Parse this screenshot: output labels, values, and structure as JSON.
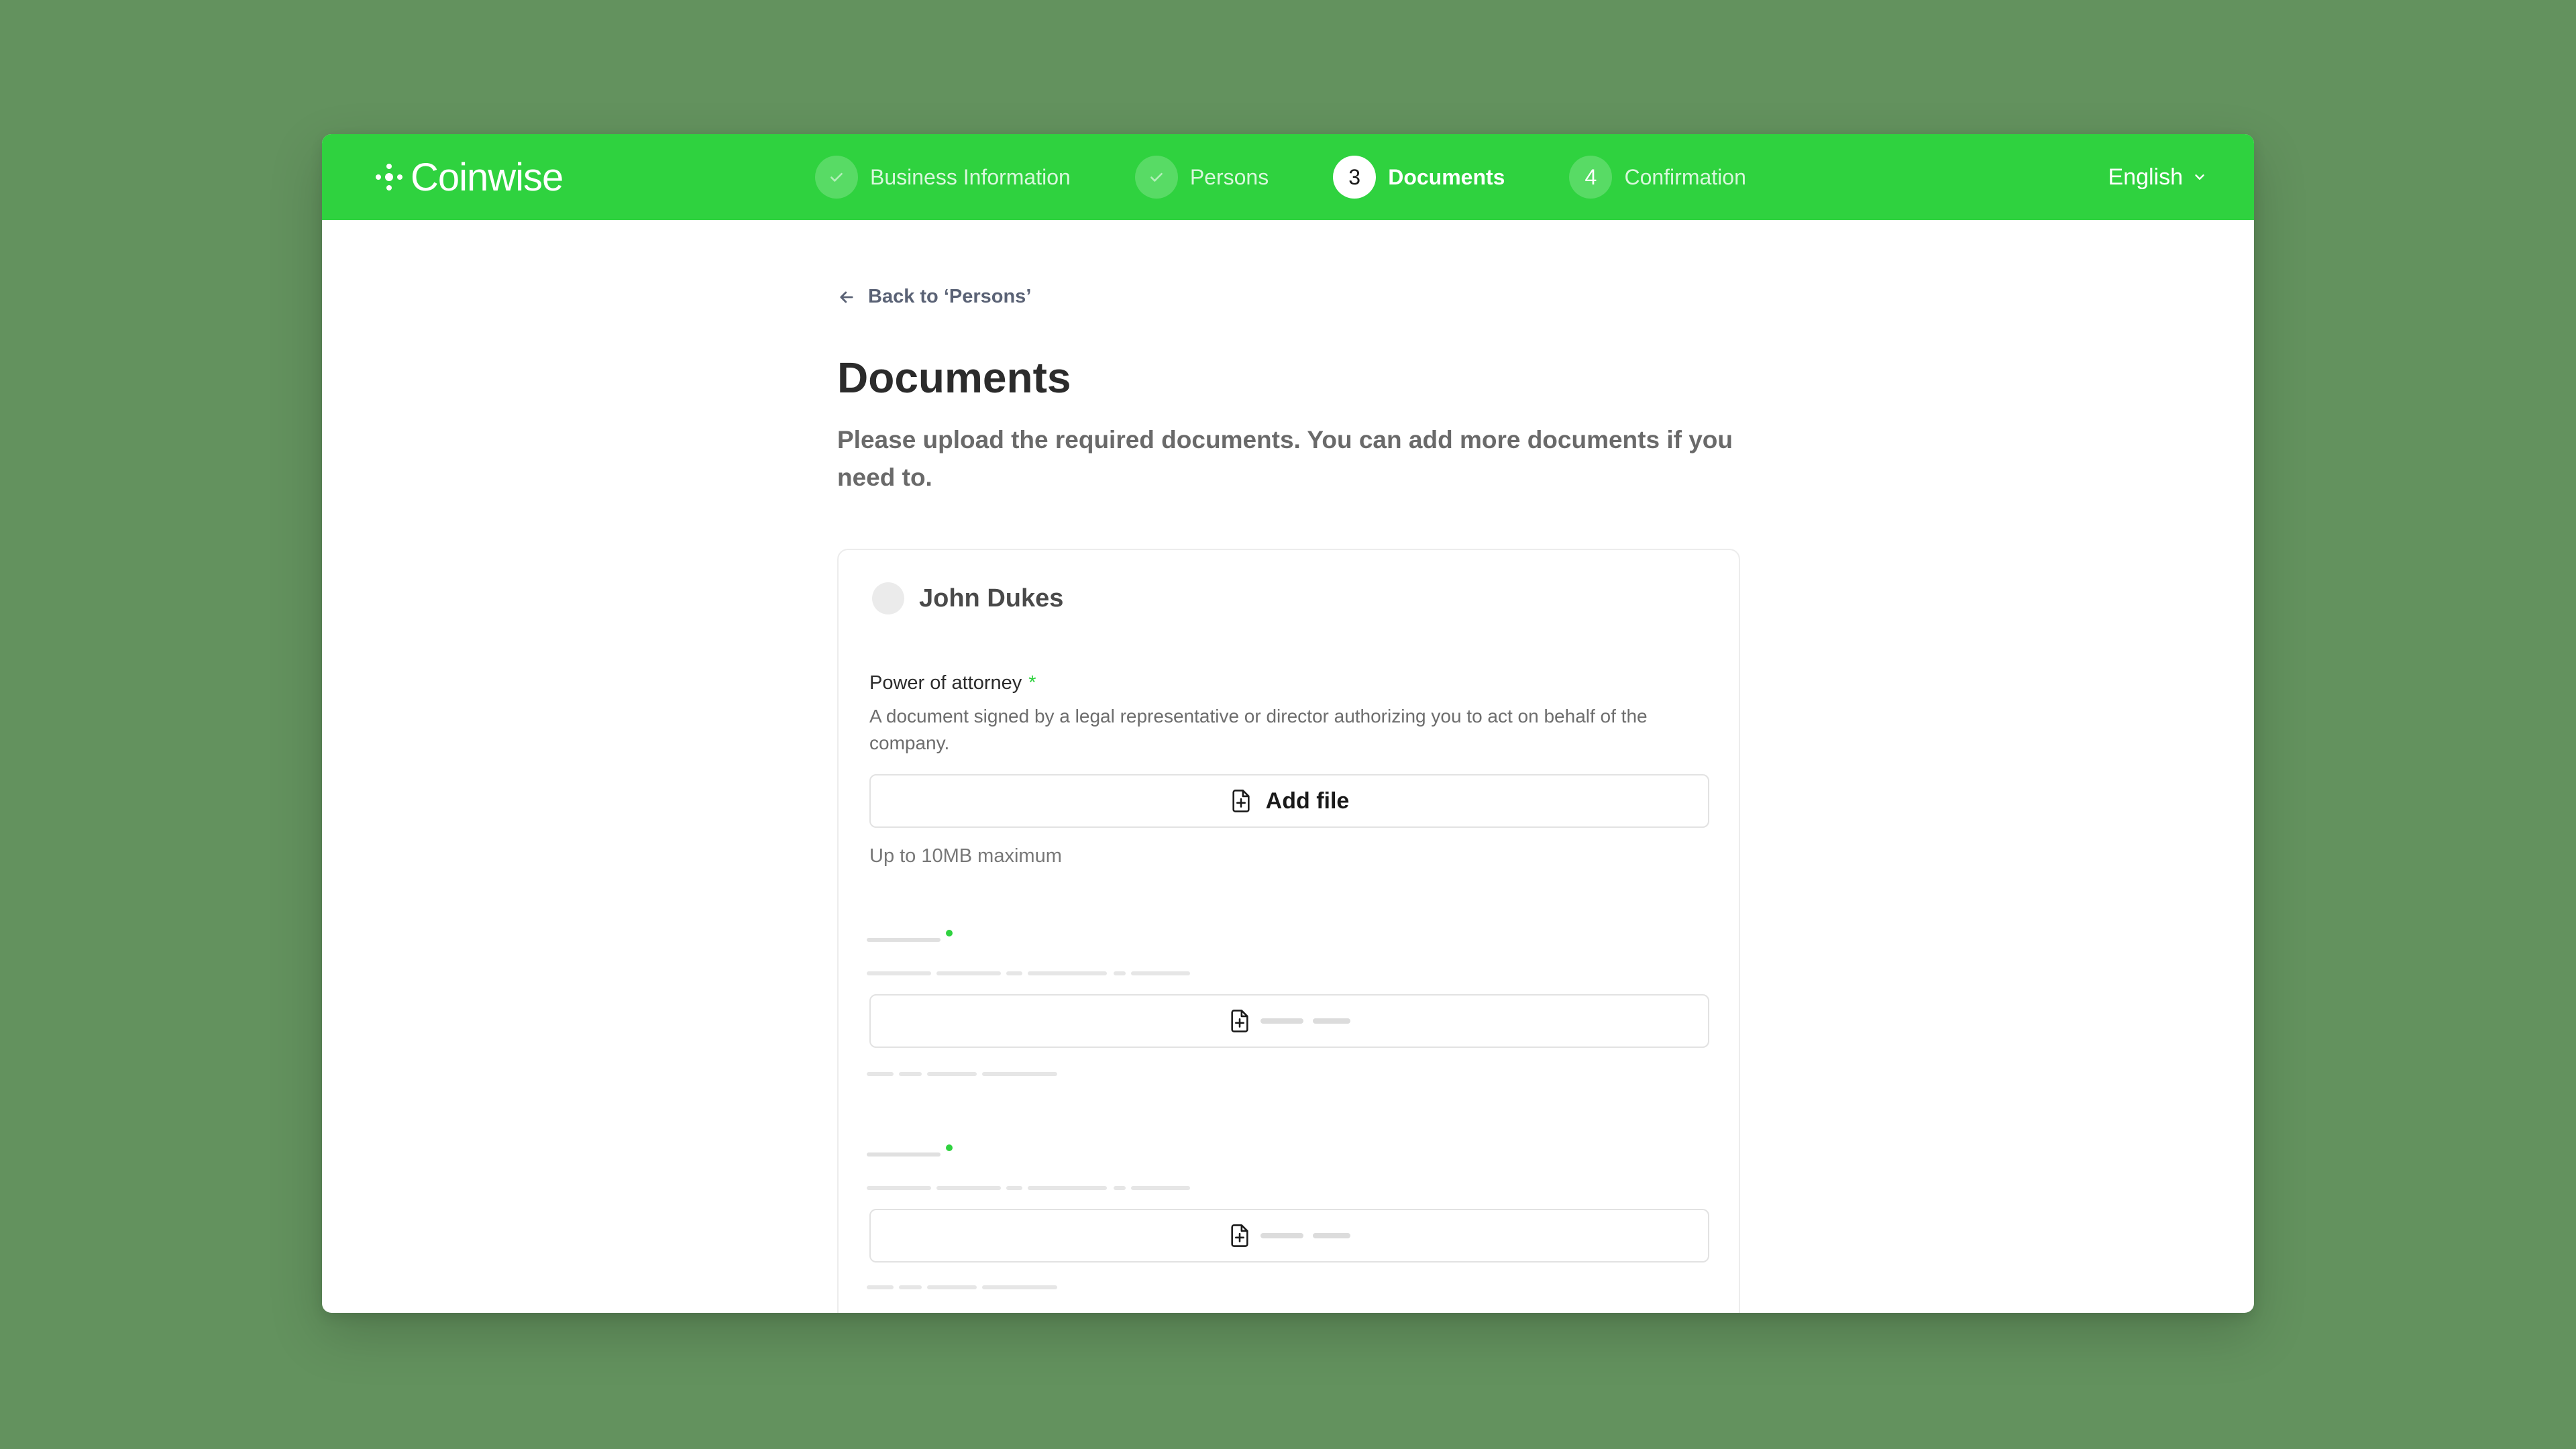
{
  "brand": {
    "name": "Coinwise",
    "color": "#2fd23f"
  },
  "steps": [
    {
      "number": "",
      "label": "Business Information",
      "state": "completed",
      "icon": "check-icon"
    },
    {
      "number": "",
      "label": "Persons",
      "state": "completed",
      "icon": "check-icon"
    },
    {
      "number": "3",
      "label": "Documents",
      "state": "active"
    },
    {
      "number": "4",
      "label": "Confirmation",
      "state": "upcoming"
    }
  ],
  "language": {
    "selected": "English",
    "icon": "chevron-down-icon"
  },
  "back_link": {
    "label": "Back to ‘Persons’",
    "icon": "arrow-left-icon"
  },
  "page": {
    "title": "Documents",
    "subtitle": "Please upload the required documents. You can add more documents if you need to."
  },
  "card": {
    "person_name": "John Dukes",
    "documents": [
      {
        "label": "Power of attorney",
        "required_mark": "*",
        "description": "A document signed by a legal representative or director authorizing you to act on behalf of the company.",
        "button_label": "Add file",
        "button_icon": "file-add-icon",
        "limit": "Up to 10MB maximum"
      },
      {
        "state": "loading-skeleton",
        "button_icon": "file-add-icon"
      },
      {
        "state": "loading-skeleton",
        "button_icon": "file-add-icon"
      }
    ]
  }
}
